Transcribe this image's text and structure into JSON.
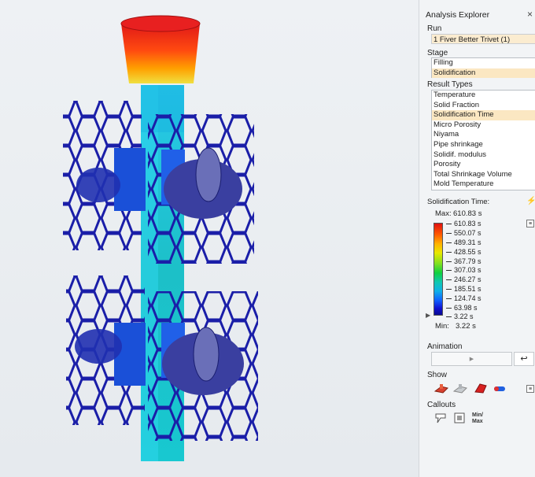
{
  "panel": {
    "title": "Analysis Explorer",
    "close_icon": "close-icon",
    "run_label": "Run",
    "run_value": "1 Fiver Better Trivet (1)",
    "stage_label": "Stage",
    "stages": [
      "Filling",
      "Solidification"
    ],
    "stage_selected": "Solidification",
    "result_types_label": "Result Types",
    "result_types": [
      "Temperature",
      "Solid Fraction",
      "Solidification Time",
      "Micro Porosity",
      "Niyama",
      "Pipe shrinkage",
      "Solidif. modulus",
      "Porosity",
      "Total Shrinkage Volume",
      "Mold Temperature"
    ],
    "result_selected": "Solidification Time"
  },
  "legend": {
    "title": "Solidification Time:",
    "max_label": "Max:",
    "max_value": "610.83 s",
    "min_label": "Min:",
    "min_value": "3.22 s",
    "ticks": [
      "610.83 s",
      "550.07 s",
      "489.31 s",
      "428.55 s",
      "367.79 s",
      "307.03 s",
      "246.27 s",
      "185.51 s",
      "124.74 s",
      "63.98 s",
      "3.22 s"
    ],
    "colors": [
      "#e01010",
      "#ff5a00",
      "#ffb000",
      "#e8e800",
      "#7ee020",
      "#10d040",
      "#10c8b0",
      "#10b0e8",
      "#1060ff",
      "#1010d0",
      "#0a0a90"
    ]
  },
  "animation": {
    "label": "Animation",
    "play_icon": "play-icon",
    "return_icon": "return-icon"
  },
  "show": {
    "label": "Show",
    "icons": [
      "part-show-icon",
      "mold-show-icon",
      "cut-show-icon",
      "cylinder-show-icon"
    ]
  },
  "callouts": {
    "label": "Callouts",
    "icons": [
      "callout-pin-icon",
      "callout-box-icon"
    ],
    "minmax_text": "Min/\nMax"
  }
}
